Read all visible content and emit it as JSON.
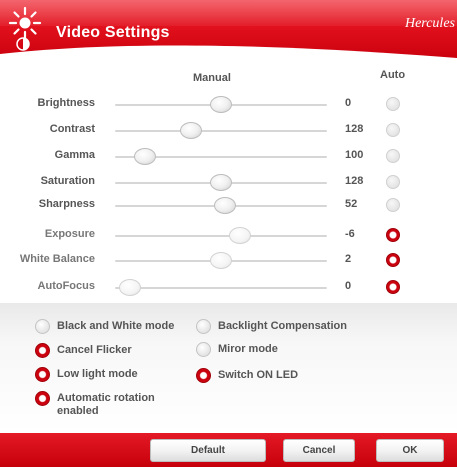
{
  "header": {
    "title": "Video Settings",
    "brand": "Hercules"
  },
  "columns": {
    "manual": "Manual",
    "auto": "Auto"
  },
  "sliders": [
    {
      "label": "Brightness",
      "value": "0",
      "level": 0.5,
      "auto": false,
      "enabled": true
    },
    {
      "label": "Contrast",
      "value": "128",
      "level": 0.34,
      "auto": false,
      "enabled": true
    },
    {
      "label": "Gamma",
      "value": "100",
      "level": 0.1,
      "auto": false,
      "enabled": true
    },
    {
      "label": "Saturation",
      "value": "128",
      "level": 0.5,
      "auto": false,
      "enabled": true
    },
    {
      "label": "Sharpness",
      "value": "52",
      "level": 0.52,
      "auto": false,
      "enabled": true
    },
    {
      "label": "Exposure",
      "value": "-6",
      "level": 0.6,
      "auto": true,
      "enabled": false
    },
    {
      "label": "White Balance",
      "value": "2",
      "level": 0.5,
      "auto": true,
      "enabled": false
    },
    {
      "label": "AutoFocus",
      "value": "0",
      "level": 0.02,
      "auto": true,
      "enabled": false
    }
  ],
  "options": {
    "black_white": {
      "label": "Black and White mode",
      "checked": false
    },
    "cancel_flicker": {
      "label": "Cancel Flicker",
      "checked": true
    },
    "low_light": {
      "label": "Low light mode",
      "checked": true
    },
    "auto_rotation": {
      "label": "Automatic rotation enabled",
      "checked": true
    },
    "backlight": {
      "label": "Backlight Compensation",
      "checked": false
    },
    "mirror": {
      "label": "Miror mode",
      "checked": false
    },
    "led": {
      "label": "Switch ON LED",
      "checked": true
    }
  },
  "buttons": {
    "default": "Default",
    "cancel": "Cancel",
    "ok": "OK"
  },
  "colors": {
    "accent": "#d80d18",
    "header": "#e0101c"
  }
}
